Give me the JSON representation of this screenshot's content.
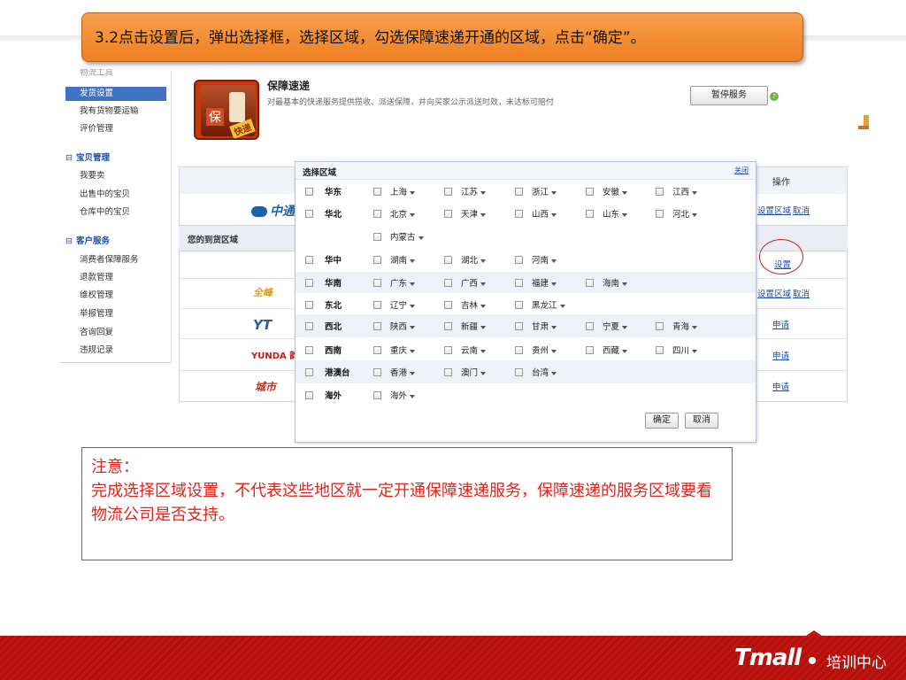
{
  "title": "3.2点击设置后，弹出选择框，选择区域，勾选保障速递开通的区域，点击“确定”。",
  "menu": {
    "top_faded": "物流工具",
    "items1": [
      "发货设置",
      "我有货物要运输",
      "评价管理"
    ],
    "group_baobei": "宝贝管理",
    "items2": [
      "我要卖",
      "出售中的宝贝",
      "仓库中的宝贝"
    ],
    "group_kehu": "客户服务",
    "items3": [
      "消费者保障服务",
      "退款管理",
      "维权管理",
      "举报管理",
      "咨询回复",
      "违规记录"
    ],
    "active_index": 0
  },
  "service": {
    "name": "保障速递",
    "desc": "对最基本的快递服务提供揽收、派送保障，并向买家公示派送时效，未达标可赔付",
    "pause_label": "暂停服务",
    "logo_bao": "保",
    "logo_kuai": "快递"
  },
  "table": {
    "op_header": "操作",
    "zone_label": "您的到货区域",
    "rows": [
      {
        "logo": "中通",
        "links": [
          "设置区域",
          "取消"
        ]
      },
      {
        "logo": "",
        "links": [
          "设置"
        ]
      },
      {
        "logo": "全峰",
        "links": [
          "设置区域",
          "取消"
        ]
      },
      {
        "logo": "YT",
        "links": [
          "申请"
        ]
      },
      {
        "logo": "YUNDA 韵达",
        "links": [
          "申请"
        ]
      },
      {
        "logo": "城市",
        "links": [
          "申请"
        ]
      }
    ]
  },
  "dialog": {
    "title": "选择区域",
    "close": "关闭",
    "regions": [
      {
        "name": "华东",
        "provinces": [
          "上海",
          "江苏",
          "浙江",
          "安徽",
          "江西"
        ]
      },
      {
        "name": "华北",
        "provinces": [
          "北京",
          "天津",
          "山西",
          "山东",
          "河北",
          "内蒙古"
        ]
      },
      {
        "name": "华中",
        "provinces": [
          "湖南",
          "湖北",
          "河南"
        ]
      },
      {
        "name": "华南",
        "provinces": [
          "广东",
          "广西",
          "福建",
          "海南"
        ]
      },
      {
        "name": "东北",
        "provinces": [
          "辽宁",
          "吉林",
          "黑龙江"
        ]
      },
      {
        "name": "西北",
        "provinces": [
          "陕西",
          "新疆",
          "甘肃",
          "宁夏",
          "青海"
        ]
      },
      {
        "name": "西南",
        "provinces": [
          "重庆",
          "云南",
          "贵州",
          "西藏",
          "四川"
        ]
      },
      {
        "name": "港澳台",
        "provinces": [
          "香港",
          "澳门",
          "台湾"
        ]
      },
      {
        "name": "海外",
        "provinces": [
          "海外"
        ]
      }
    ],
    "ok_label": "确定",
    "cancel_label": "取消"
  },
  "note": {
    "heading": "注意：",
    "body": "完成选择区域设置，不代表这些地区就一定开通保障速递服务，保障速递的服务区域要看物流公司是否支持。"
  },
  "footer": {
    "brand": "Tmall",
    "center": "培训中心"
  },
  "colors": {
    "title_bg": "#ef7f22",
    "footer_red": "#c3150f",
    "link_blue": "#1c4fa8",
    "note_red": "#e2231a",
    "menu_active": "#3f71c4"
  }
}
